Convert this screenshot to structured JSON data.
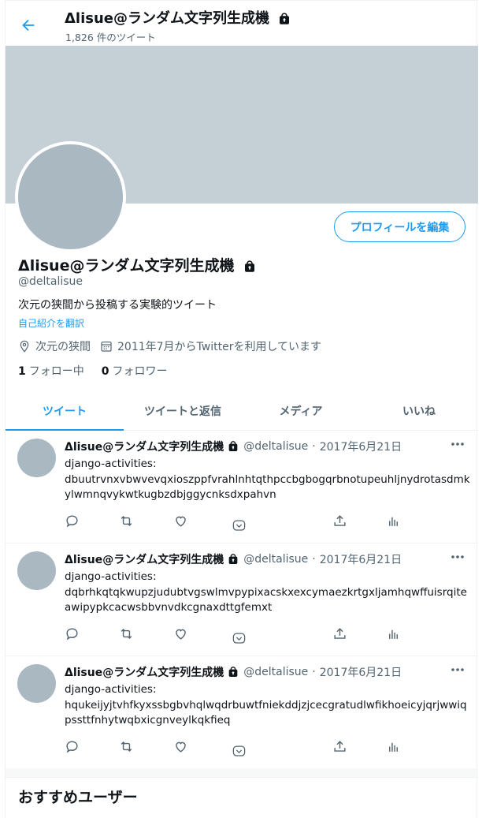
{
  "header": {
    "title": "Δlisue@ランダム文字列生成機",
    "tweet_count": "1,826 件のツイート"
  },
  "profile": {
    "name": "Δlisue@ランダム文字列生成機",
    "handle": "@deltalisue",
    "bio": "次元の狭間から投稿する実験的ツイート",
    "translate_link": "自己紹介を翻訳",
    "location": "次元の狭間",
    "joined": "2011年7月からTwitterを利用しています",
    "following_count": "1",
    "following_label": "フォロー中",
    "followers_count": "0",
    "followers_label": "フォロワー",
    "edit_button": "プロフィールを編集"
  },
  "tabs": [
    "ツイート",
    "ツイートと返信",
    "メディア",
    "いいね"
  ],
  "tweets": [
    {
      "name": "Δlisue@ランダム文字列生成機",
      "handle": "@deltalisue",
      "dot": "·",
      "date": "2017年6月21日",
      "text": "django-activities:\ndbuutrvnxvbwvevqxioszppfvrahlnhtqthpccbgbogqrbnotupeuhljnydrotasdmkylwmnqvykwtkugbzdbjggycnksdxpahvn"
    },
    {
      "name": "Δlisue@ランダム文字列生成機",
      "handle": "@deltalisue",
      "dot": "·",
      "date": "2017年6月21日",
      "text": "django-activities:\ndqbrhkqtqkwupzjudubtvgswlmvpypixacskxexcymaezkrtgxljamhqwffuisrqiteawipypkcacwsbbvnvdkcgnaxdttgfemxt"
    },
    {
      "name": "Δlisue@ランダム文字列生成機",
      "handle": "@deltalisue",
      "dot": "·",
      "date": "2017年6月21日",
      "text": "django-activities:\nhqukeijyjtvhfkyxssbgbvhqlwqdrbuwtfniekddjzjcecgratudlwfikhoeicyjqrjwwiqpssttfnhytwqbxicgnveylkqkfieq"
    }
  ],
  "recommendations_title": "おすすめユーザー",
  "colors": {
    "accent": "#1d9bf0",
    "banner": "#c4cfd6",
    "avatar": "#aab8c2",
    "muted_text": "#536471"
  }
}
